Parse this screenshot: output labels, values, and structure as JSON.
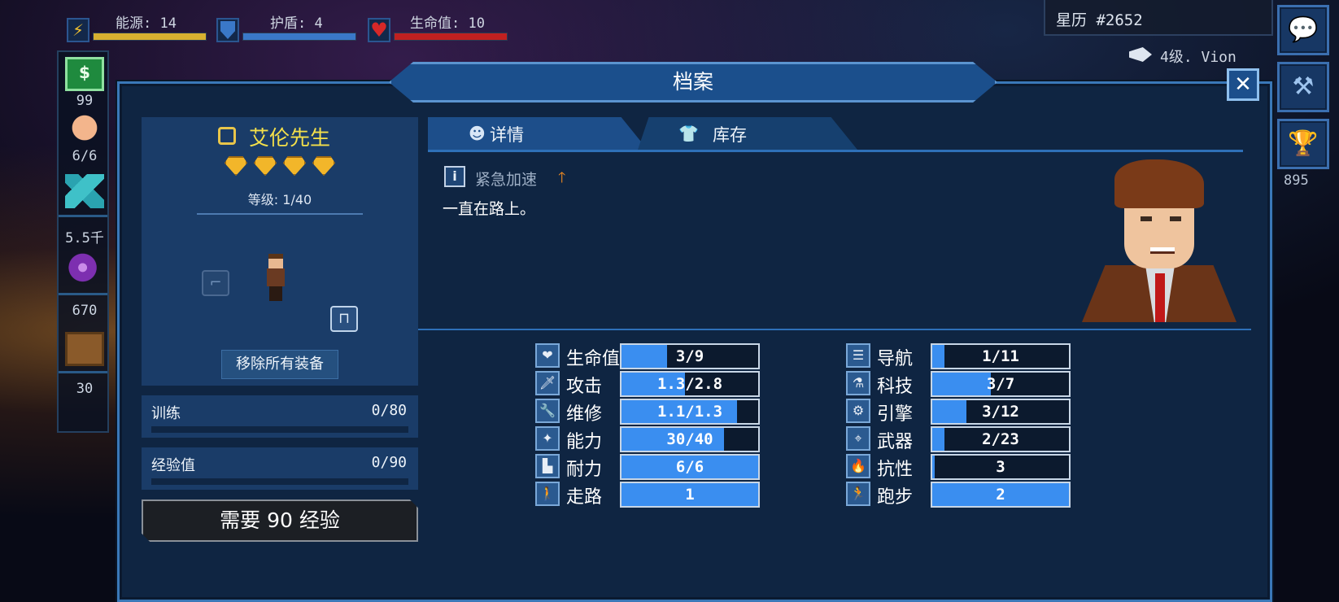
{
  "hud": {
    "energy": {
      "label": "能源: 14",
      "fill": 1.0,
      "color": "#d8b030"
    },
    "shield": {
      "label": "护盾: 4",
      "fill": 1.0,
      "color": "#3a78c8"
    },
    "health": {
      "label": "生命值: 10",
      "fill": 1.0,
      "color": "#c02020"
    },
    "stardate": "星历 #2652",
    "ship_level": "4级. Vion"
  },
  "resources": [
    {
      "icon": "money-icon",
      "symbol": "$",
      "value": "99"
    },
    {
      "icon": "crew-face-icon",
      "value": "6/6"
    },
    {
      "icon": "crystal-icon",
      "value": "5.5千"
    },
    {
      "icon": "orb-icon",
      "value": "670"
    },
    {
      "icon": "crate-icon",
      "value": "30"
    }
  ],
  "side_buttons": [
    {
      "icon": "chat-icon",
      "glyph": "💬"
    },
    {
      "icon": "hammer-icon",
      "glyph": "⚒"
    },
    {
      "icon": "trophy-icon",
      "glyph": "🏆"
    }
  ],
  "trophy_count": "895",
  "panel": {
    "title": "档案",
    "close_glyph": "✕"
  },
  "crew": {
    "name": "艾伦先生",
    "rank_gems": 4,
    "level": "等级: 1/40",
    "remove_button": "移除所有装备",
    "training": {
      "label": "训练",
      "value": "0/80",
      "progress": 0
    },
    "experience": {
      "label": "经验值",
      "value": "0/90",
      "progress": 0
    },
    "need_button": "需要 90 经验"
  },
  "tabs": [
    {
      "label": "详情",
      "active": true
    },
    {
      "label": "库存",
      "active": false
    }
  ],
  "trait": {
    "name": "紧急加速",
    "bio": "一直在路上。"
  },
  "stats_left": [
    {
      "label": "生命值",
      "value": "3/9",
      "fill": 0.333,
      "icon": "heart-icon",
      "glyph": "❤"
    },
    {
      "label": "攻击",
      "value": "1.3/2.8",
      "fill": 0.464,
      "icon": "sword-icon",
      "glyph": "🗡"
    },
    {
      "label": "维修",
      "value": "1.1/1.3",
      "fill": 0.846,
      "icon": "wrench-icon",
      "glyph": "🔧"
    },
    {
      "label": "能力",
      "value": "30/40",
      "fill": 0.75,
      "icon": "ability-icon",
      "glyph": "✦"
    },
    {
      "label": "耐力",
      "value": "6/6",
      "fill": 1.0,
      "icon": "boot-icon",
      "glyph": "▙"
    },
    {
      "label": "走路",
      "value": "1",
      "fill": 1.0,
      "icon": "walk-icon",
      "glyph": "🚶"
    }
  ],
  "stats_right": [
    {
      "label": "导航",
      "value": "1/11",
      "fill": 0.091,
      "icon": "navigation-icon",
      "glyph": "☰"
    },
    {
      "label": "科技",
      "value": "3/7",
      "fill": 0.429,
      "icon": "flask-icon",
      "glyph": "⚗"
    },
    {
      "label": "引擎",
      "value": "3/12",
      "fill": 0.25,
      "icon": "engine-icon",
      "glyph": "⚙"
    },
    {
      "label": "武器",
      "value": "2/23",
      "fill": 0.087,
      "icon": "crosshair-icon",
      "glyph": "⌖"
    },
    {
      "label": "抗性",
      "value": "3",
      "fill": 0.02,
      "icon": "fire-icon",
      "glyph": "🔥"
    },
    {
      "label": "跑步",
      "value": "2",
      "fill": 1.0,
      "icon": "run-icon",
      "glyph": "🏃"
    }
  ]
}
